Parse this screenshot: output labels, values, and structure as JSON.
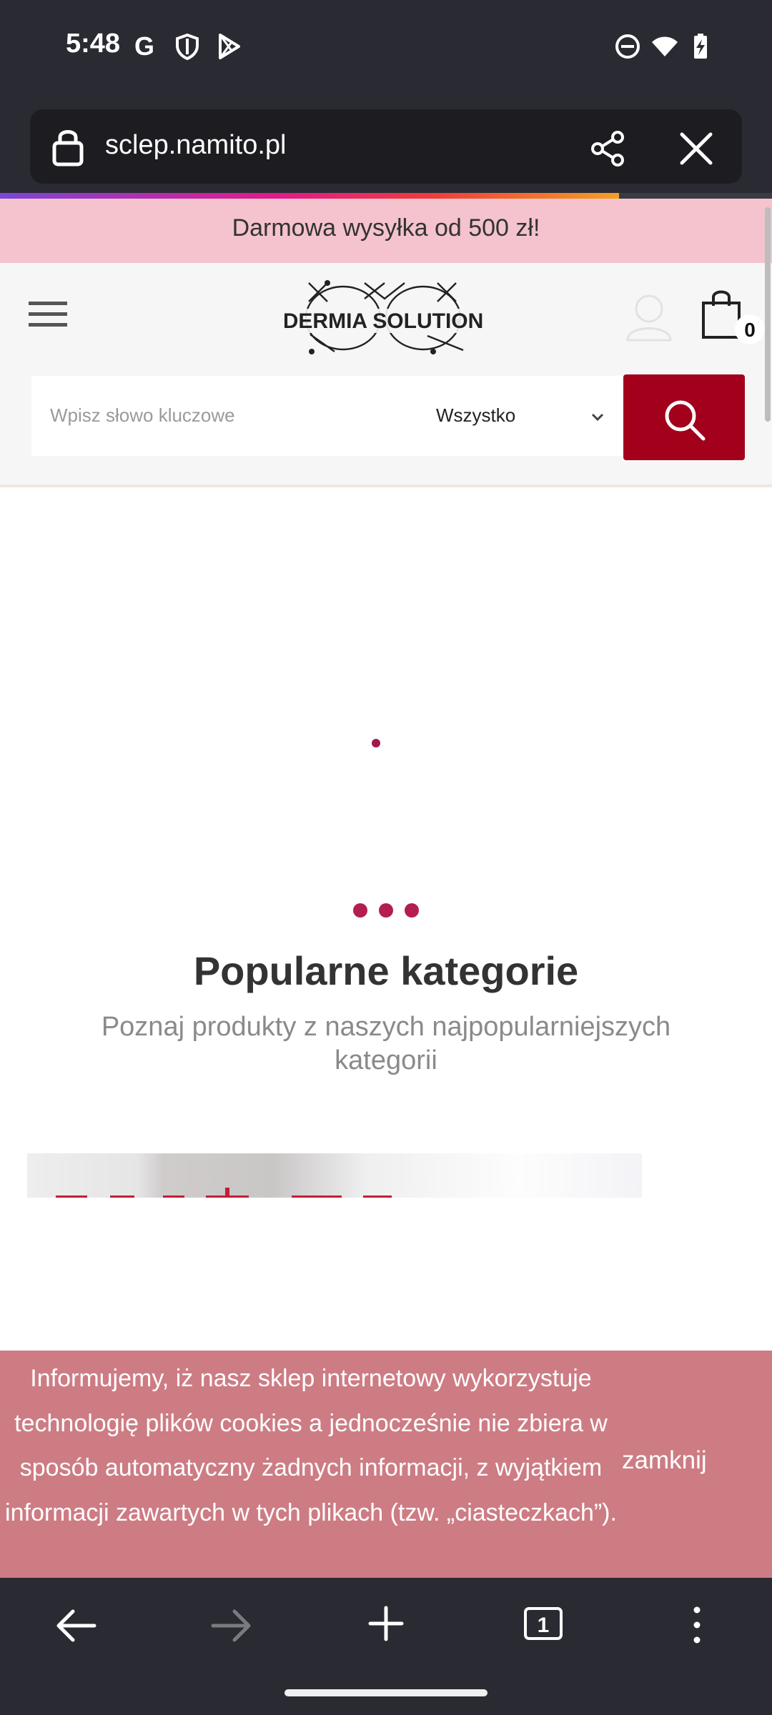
{
  "status_bar": {
    "time": "5:48",
    "icons_left": [
      "google-icon",
      "shield-icon",
      "play-store-icon"
    ],
    "icons_right": [
      "dnd-icon",
      "wifi-icon",
      "battery-charging-icon"
    ]
  },
  "browser": {
    "url": "sclep.namito.pl",
    "lock_icon": "lock-icon",
    "share_icon": "share-icon",
    "close_icon": "close-icon"
  },
  "promo": {
    "text": "Darmowa wysyłka od 500 zł!"
  },
  "header": {
    "brand": "DERMIA SOLUTION",
    "cart_count": "0"
  },
  "search": {
    "placeholder": "Wpisz słowo kluczowe",
    "category": "Wszystko"
  },
  "categories": {
    "title": "Popularne kategorie",
    "subtitle": "Poznaj produkty z naszych najpopularniejszych kategorii"
  },
  "cookie_notice": {
    "text": "Informujemy, iż nasz sklep internetowy wykorzystuje technologię plików cookies a jednocześnie nie zbiera w sposób automatyczny żadnych informacji, z wyjątkiem informacji zawartych w tych plikach (tzw. „ciasteczkach”).",
    "close_label": "zamknij"
  },
  "bottom_nav": {
    "tab_count": "1"
  },
  "colors": {
    "accent": "#a3001b",
    "promo_bg": "#f4c3cd",
    "cookie_bg": "#cd7c84",
    "chrome_bg": "#2a2a33"
  }
}
